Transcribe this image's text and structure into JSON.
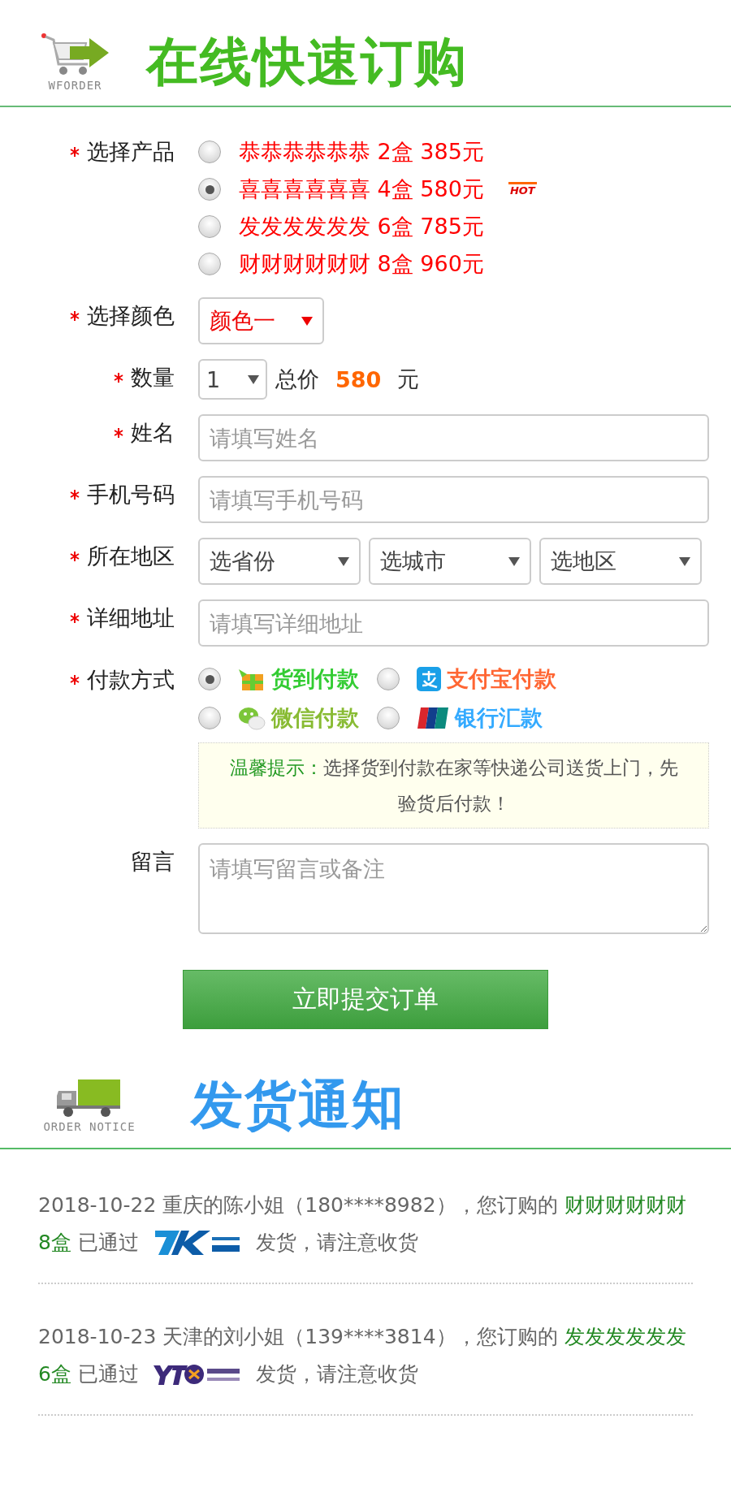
{
  "header": {
    "logo_caption": "WFORDER",
    "title": "在线快速订购"
  },
  "form": {
    "product": {
      "label": "选择产品",
      "required": true,
      "options": [
        {
          "text": "恭恭恭恭恭恭 2盒 385元",
          "selected": false
        },
        {
          "text": "喜喜喜喜喜喜 4盒 580元",
          "selected": true,
          "hot_text": "HOT"
        },
        {
          "text": "发发发发发发 6盒 785元",
          "selected": false
        },
        {
          "text": "财财财财财财 8盒 960元",
          "selected": false
        }
      ]
    },
    "color": {
      "label": "选择颜色",
      "required": true,
      "value": "颜色一"
    },
    "quantity": {
      "label": "数量",
      "required": true,
      "value": "1",
      "total_label": "总价",
      "total": "580",
      "unit": "元"
    },
    "name": {
      "label": "姓名",
      "required": true,
      "placeholder": "请填写姓名"
    },
    "phone": {
      "label": "手机号码",
      "required": true,
      "placeholder": "请填写手机号码"
    },
    "region": {
      "label": "所在地区",
      "required": true,
      "selects": [
        "选省份",
        "选城市",
        "选地区"
      ]
    },
    "address": {
      "label": "详细地址",
      "required": true,
      "placeholder": "请填写详细地址"
    },
    "payment": {
      "label": "付款方式",
      "required": true,
      "options": [
        {
          "text": "货到付款",
          "kind": "cod",
          "color": "#33cc33",
          "selected": true
        },
        {
          "text": "支付宝付款",
          "kind": "alipay",
          "color": "#ff6633",
          "selected": false
        },
        {
          "text": "微信付款",
          "kind": "wechat",
          "color": "#88bb33",
          "selected": false
        },
        {
          "text": "银行汇款",
          "kind": "unionpay",
          "color": "#33aaff",
          "selected": false
        }
      ],
      "tip_title": "温馨提示：",
      "tip_text": "选择货到付款在家等快递公司送货上门，先验货后付款！"
    },
    "message": {
      "label": "留言",
      "required": false,
      "placeholder": "请填写留言或备注"
    },
    "submit": "立即提交订单"
  },
  "notice": {
    "caption": "ORDER NOTICE",
    "title": "发货通知",
    "items": [
      {
        "lead": "2018-10-22 重庆的陈小姐（180****8982），您订购的",
        "product": "财财财财财财",
        "amount": "8盒",
        "via": "已通过",
        "kind": "zjs",
        "after": "发货，请注意收货"
      },
      {
        "lead": "2018-10-23 天津的刘小姐（139****3814），您订购的",
        "product": "发发发发发发",
        "amount": "6盒",
        "via": "已通过",
        "kind": "yto",
        "after": "发货，请注意收货"
      }
    ]
  }
}
